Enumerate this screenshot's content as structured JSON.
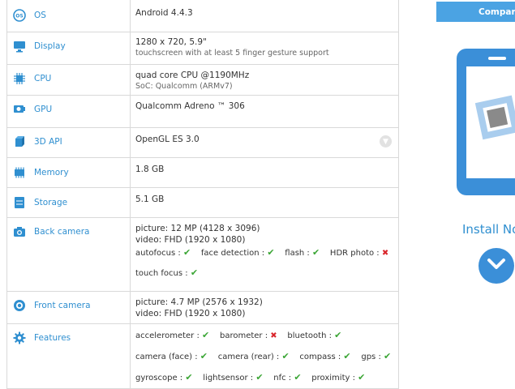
{
  "specs": {
    "os": {
      "label": "OS",
      "value": "Android 4.4.3"
    },
    "display": {
      "label": "Display",
      "value": "1280 x 720, 5.9\"",
      "sub": "touchscreen with at least 5 finger gesture support"
    },
    "cpu": {
      "label": "CPU",
      "value": "quad core CPU @1190MHz",
      "sub": "SoC: Qualcomm (ARMv7)"
    },
    "gpu": {
      "label": "GPU",
      "value": "Qualcomm Adreno ™ 306"
    },
    "api3d": {
      "label": "3D API",
      "value": "OpenGL ES 3.0"
    },
    "memory": {
      "label": "Memory",
      "value": "1.8 GB"
    },
    "storage": {
      "label": "Storage",
      "value": "5.1 GB"
    },
    "back_camera": {
      "label": "Back camera",
      "picture": "picture: 12 MP (4128 x 3096)",
      "video": "video: FHD (1920 x 1080)",
      "autofocus": "autofocus :",
      "face_detection": "face detection :",
      "flash": "flash :",
      "hdr_photo": "HDR photo :",
      "touch_focus": "touch focus :"
    },
    "front_camera": {
      "label": "Front camera",
      "picture": "picture: 4.7 MP (2576 x 1932)",
      "video": "video: FHD (1920 x 1080)"
    },
    "features": {
      "label": "Features",
      "accelerometer": "accelerometer :",
      "barometer": "barometer :",
      "bluetooth": "bluetooth :",
      "camera_face": "camera (face) :",
      "camera_rear": "camera (rear) :",
      "compass": "compass :",
      "gps": "gps :",
      "gyroscope": "gyroscope :",
      "lightsensor": "lightsensor :",
      "nfc": "nfc :",
      "proximity": "proximity :"
    }
  },
  "marks": {
    "check": "✔",
    "cross": "✖"
  },
  "sidebar": {
    "compare_label": "Compare",
    "install_label": "Install No"
  },
  "colors": {
    "accent": "#2f8fd0",
    "check": "#3aa534",
    "cross": "#d9262c",
    "button": "#4ba3e3"
  }
}
